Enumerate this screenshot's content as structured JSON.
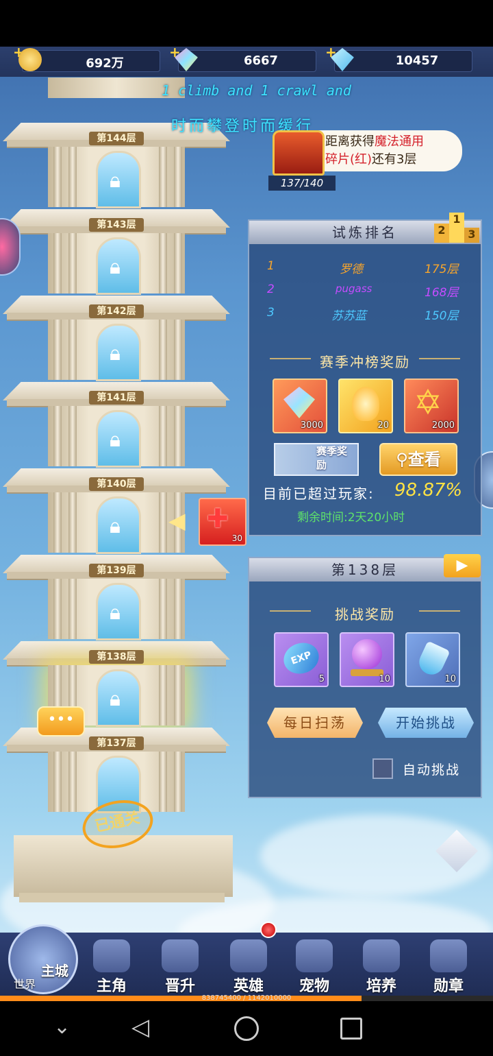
{
  "currency": {
    "gold": "692万",
    "diamond": "6667",
    "crystal": "10457"
  },
  "title": {
    "en": "1 climb and 1 crawl and",
    "cn": "时而攀登时而缓行"
  },
  "tip": {
    "prefix": "距离获得",
    "highlight": "魔法通用",
    "line2_hl": "碎片(红)",
    "line2_rest": "还有3层",
    "progress": "137/140"
  },
  "floors": [
    "第144层",
    "第143层",
    "第142层",
    "第141层",
    "第140层",
    "第139层",
    "第138层",
    "第137层"
  ],
  "cleared_stamp": "已通关",
  "side_reward_count": "30",
  "chat_bubble": "•••",
  "ranking": {
    "title": "试炼排名",
    "rows": [
      {
        "rank": "1",
        "name": "罗德",
        "floor": "175层"
      },
      {
        "rank": "2",
        "name": "pugass",
        "floor": "168层"
      },
      {
        "rank": "3",
        "name": "苏苏蓝",
        "floor": "150层"
      }
    ],
    "season_title": "赛季冲榜奖励",
    "rewards": [
      "3000",
      "20",
      "2000"
    ],
    "season_banner": "赛季奖励",
    "view_button": "查看",
    "surpass_label": "目前已超过玩家:",
    "surpass_value": "98.87%",
    "remaining": "剩余时间:2天20小时"
  },
  "challenge": {
    "title": "第138层",
    "reward_title": "挑战奖励",
    "rewards": [
      {
        "icon": "EXP",
        "count": "5"
      },
      {
        "icon": "orb",
        "count": "10"
      },
      {
        "icon": "potion",
        "count": "10"
      }
    ],
    "sweep_button": "每日扫荡",
    "start_button": "开始挑战",
    "auto_label": "自动挑战"
  },
  "nav": {
    "world": "世界",
    "main_city": "主城",
    "items": [
      "主角",
      "晋升",
      "英雄",
      "宠物",
      "培养",
      "勋章"
    ]
  },
  "exp": {
    "text": "838745400 / 1142010000",
    "fraction": 0.734
  },
  "colors": {
    "accent_gold": "#f2b43a",
    "rank1": "#f7a52c",
    "rank2": "#c54cff",
    "rank3": "#4ec9ff",
    "surpass": "#ffe243",
    "remaining": "#5fe36a"
  }
}
